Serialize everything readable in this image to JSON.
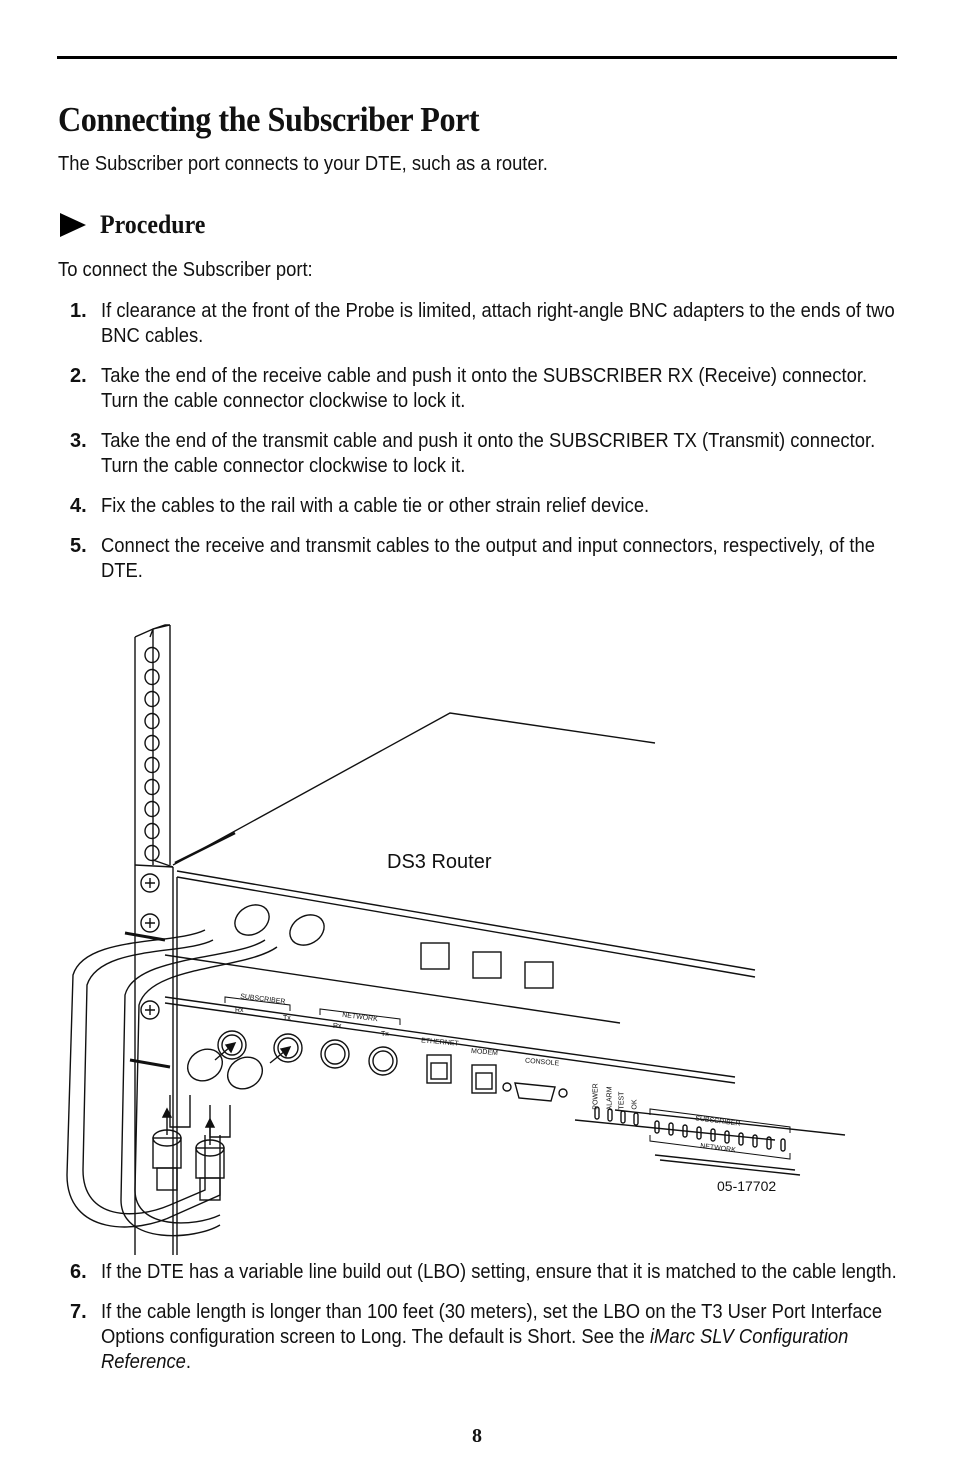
{
  "page": {
    "title": "Connecting the Subscriber Port",
    "intro": "The Subscriber port connects to your DTE, such as a router.",
    "procedure_heading": "Procedure",
    "lead_in": "To connect the Subscriber port:",
    "page_number": "8"
  },
  "steps_before_figure": [
    {
      "num": "1.",
      "text": "If clearance at the front of the Probe is limited, attach right-angle BNC adapters to the ends of two BNC cables."
    },
    {
      "num": "2.",
      "text": "Take the end of the receive cable and push it onto the SUBSCRIBER RX (Receive) connector. Turn the cable connector clockwise to lock it."
    },
    {
      "num": "3.",
      "text": "Take the end of the transmit cable and push it onto the SUBSCRIBER TX (Transmit) connector. Turn the cable connector clockwise to lock it."
    },
    {
      "num": "4.",
      "text": "Fix the cables to the rail with a cable tie or other strain relief device."
    },
    {
      "num": "5.",
      "text": "Connect the receive and transmit cables to the output and input connectors, respectively, of the DTE."
    }
  ],
  "steps_after_figure": [
    {
      "num": "6.",
      "text": "If the DTE has a variable line build out (LBO) setting, ensure that it is matched to the cable length."
    },
    {
      "num": "7.",
      "text": "If the cable length is longer than 100 feet (30 meters), set the LBO on the T3 User Port Interface Options configuration screen to Long. The default is Short. See the ",
      "ref": "iMarc SLV Configuration Reference",
      "end": "."
    }
  ],
  "figure": {
    "router_label": "DS3 Router",
    "figure_id": "05-17702",
    "panel_labels": {
      "subscriber": "SUBSCRIBER",
      "network": "NETWORK",
      "rx": "Rx",
      "tx": "Tx",
      "ethernet": "ETHERNET",
      "modem": "MODEM",
      "console": "CONSOLE",
      "power": "POWER",
      "alarm": "ALARM",
      "test": "TEST",
      "ok": "OK"
    }
  }
}
